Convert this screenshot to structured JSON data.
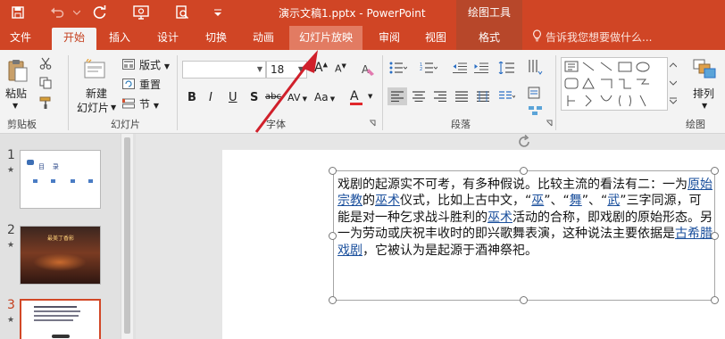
{
  "titlebar": {
    "title": "演示文稿1.pptx - PowerPoint",
    "context_title": "绘图工具"
  },
  "tabs": [
    "文件",
    "开始",
    "插入",
    "设计",
    "切换",
    "动画",
    "幻灯片放映",
    "审阅",
    "视图",
    "格式"
  ],
  "tellme": "告诉我您想要做什么...",
  "ribbon": {
    "clipboard": {
      "paste": "粘贴",
      "label": "剪贴板"
    },
    "slides": {
      "new_slide_1": "新建",
      "new_slide_2": "幻灯片",
      "layout": "版式",
      "reset": "重置",
      "section": "节",
      "label": "幻灯片"
    },
    "font": {
      "name": "",
      "size": "18",
      "label": "字体",
      "bold": "B",
      "italic": "I",
      "underline": "U",
      "strike": "S",
      "shadow": "abc",
      "spacing": "AV",
      "case": "Aa",
      "grow": "A",
      "shrink": "A",
      "color": "A"
    },
    "paragraph": {
      "label": "段落"
    },
    "drawing": {
      "arrange": "排列",
      "label": "绘图"
    }
  },
  "slides_pane": {
    "slides": [
      {
        "number": "1",
        "thumb_title": "目    录"
      },
      {
        "number": "2",
        "thumb_title": "最美丁香影"
      },
      {
        "number": "3",
        "thumb_title": ""
      }
    ]
  },
  "slide_text": {
    "t1": "戏剧的起源实不可考，有多种假说。比较主流的看法有二：一为",
    "l1": "原始宗教",
    "t2": "的",
    "l2": "巫术",
    "t3": "仪式，比如上古中文，“",
    "l3": "巫",
    "t4": "”、“",
    "l4": "舞",
    "t5": "”、“",
    "l5": "武",
    "t6": "”三字同源，可能是对一种乞求战斗胜利的",
    "l6": "巫术",
    "t7": "活动的合称，即戏剧的原始形态。另一为劳动或庆祝丰收时的即兴歌舞表演，这种说法主要依据是",
    "l7": "古希腊戏剧",
    "t8": "，它被认为是起源于酒神祭祀。"
  },
  "colors": {
    "accent": "#d04525",
    "tab_highlight": "#e27b62",
    "link": "#1a4f9c",
    "arrow": "#d0202b"
  }
}
